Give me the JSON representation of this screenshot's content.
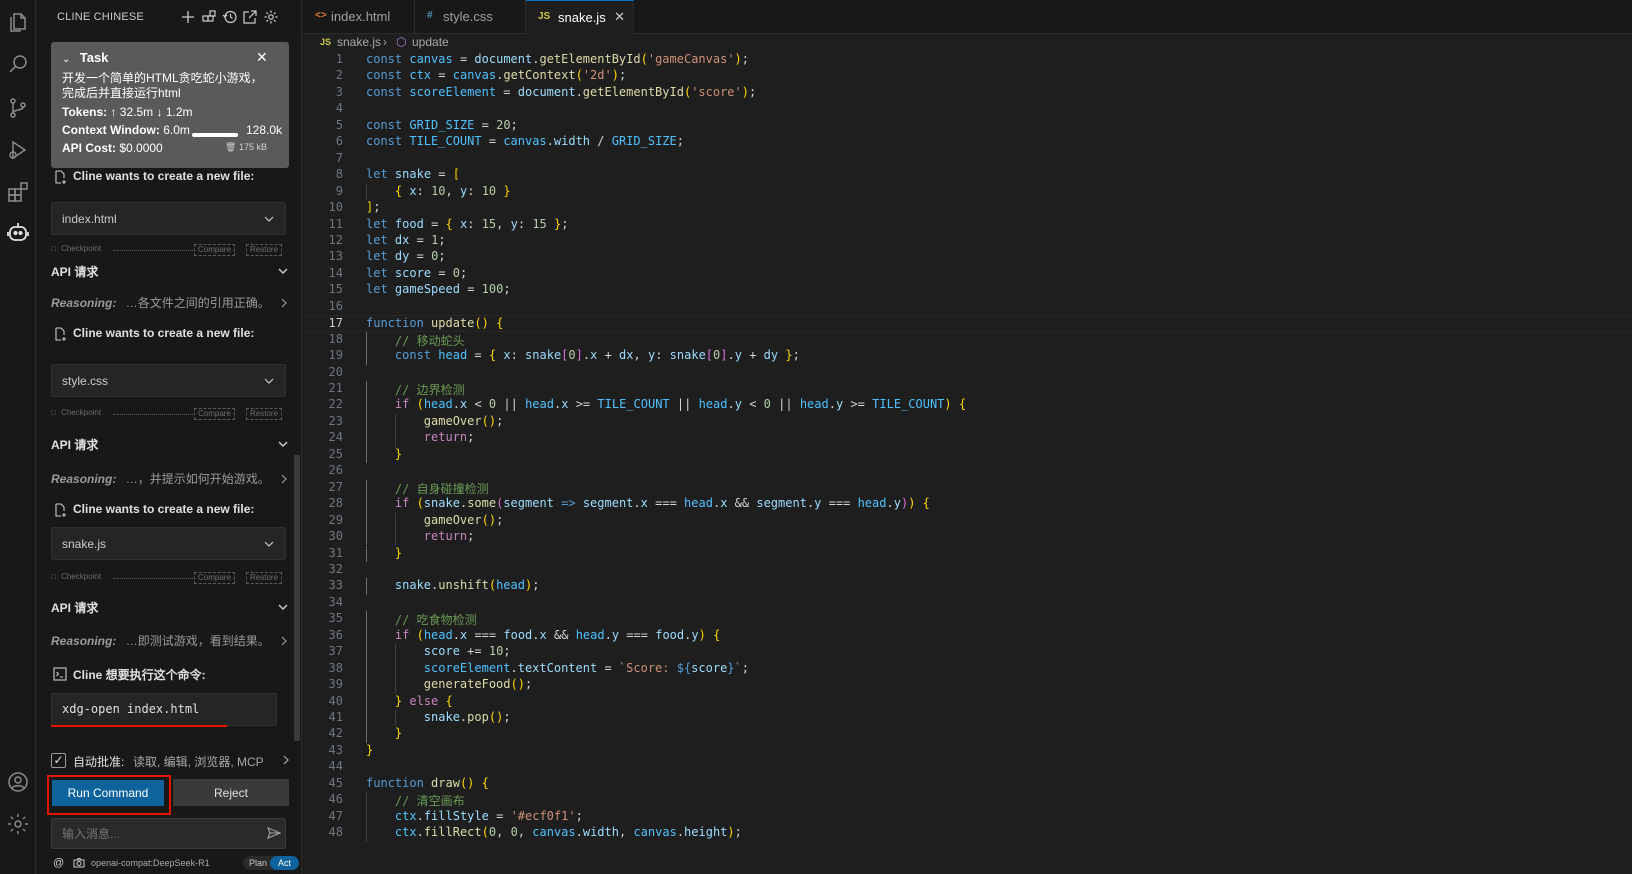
{
  "sidebar": {
    "title": "CLINE CHINESE",
    "task": {
      "label": "Task",
      "description": "开发一个简单的HTML贪吃蛇小游戏，完成后并直接运行html",
      "tokens_label": "Tokens:",
      "tokens_up": "↑ 32.5m",
      "tokens_down": "↓ 1.2m",
      "context_label": "Context Window:",
      "context_used": "6.0m",
      "context_max": "128.0k",
      "context_fill": 1.0,
      "cost_label": "API Cost:",
      "cost_value": "$0.0000",
      "size": "175 kB"
    },
    "create_file_label": "Cline wants to create a new file:",
    "files": [
      "index.html",
      "style.css",
      "snake.js"
    ],
    "checkpoint_label": "Checkpoint",
    "compare_label": "Compare",
    "restore_label": "Restore",
    "api_request_label": "API 请求",
    "reasoning_label": "Reasoning:",
    "reasonings": [
      "…各文件之间的引用正确。",
      "…，并提示如何开始游戏。",
      "…即测试游戏，看到结果。"
    ],
    "command_label": "Cline 想要执行这个命令:",
    "command": "xdg-open index.html",
    "auto_approve_label": "自动批准:",
    "auto_approve_value": "读取, 编辑, 浏览器, MCP",
    "auto_approve_checked": true,
    "run_label": "Run Command",
    "reject_label": "Reject",
    "input_placeholder": "输入消息...",
    "footer_at": "@",
    "model": "openai-compat:DeepSeek-R1",
    "plan_label": "Plan",
    "act_label": "Act"
  },
  "editor": {
    "tabs": [
      {
        "name": "index.html",
        "icon": "<>"
      },
      {
        "name": "style.css",
        "icon": "#"
      },
      {
        "name": "snake.js",
        "icon": "JS",
        "active": true
      }
    ],
    "breadcrumb": {
      "file": "snake.js",
      "symbol": "update"
    },
    "current_line": 17,
    "lines": [
      "const canvas = document.getElementById('gameCanvas');",
      "const ctx = canvas.getContext('2d');",
      "const scoreElement = document.getElementById('score');",
      "",
      "const GRID_SIZE = 20;",
      "const TILE_COUNT = canvas.width / GRID_SIZE;",
      "",
      "let snake = [",
      "    { x: 10, y: 10 }",
      "];",
      "let food = { x: 15, y: 15 };",
      "let dx = 1;",
      "let dy = 0;",
      "let score = 0;",
      "let gameSpeed = 100;",
      "",
      "function update() {",
      "    // 移动蛇头",
      "    const head = { x: snake[0].x + dx, y: snake[0].y + dy };",
      "",
      "    // 边界检测",
      "    if (head.x < 0 || head.x >= TILE_COUNT || head.y < 0 || head.y >= TILE_COUNT) {",
      "        gameOver();",
      "        return;",
      "    }",
      "",
      "    // 自身碰撞检测",
      "    if (snake.some(segment => segment.x === head.x && segment.y === head.y)) {",
      "        gameOver();",
      "        return;",
      "    }",
      "",
      "    snake.unshift(head);",
      "",
      "    // 吃食物检测",
      "    if (head.x === food.x && head.y === food.y) {",
      "        score += 10;",
      "        scoreElement.textContent = `Score: ${score}`;",
      "        generateFood();",
      "    } else {",
      "        snake.pop();",
      "    }",
      "}",
      "",
      "function draw() {",
      "    // 清空画布",
      "    ctx.fillStyle = '#ecf0f1';",
      "    ctx.fillRect(0, 0, canvas.width, canvas.height);"
    ]
  }
}
